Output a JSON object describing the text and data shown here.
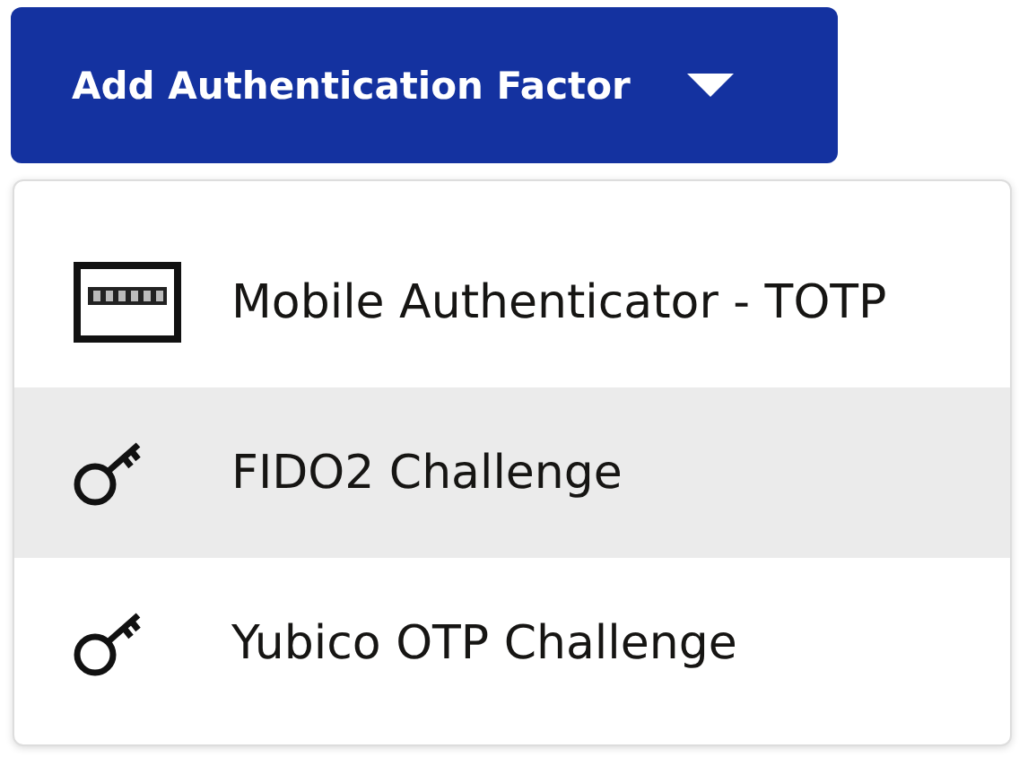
{
  "button": {
    "label": "Add Authentication Factor",
    "expanded": true
  },
  "menu": {
    "items": [
      {
        "label": "Mobile Authenticator - TOTP",
        "kind": "device",
        "selected": false
      },
      {
        "label": "FIDO2 Challenge",
        "kind": "key",
        "selected": true
      },
      {
        "label": "Yubico OTP Challenge",
        "kind": "key",
        "selected": false
      }
    ]
  }
}
